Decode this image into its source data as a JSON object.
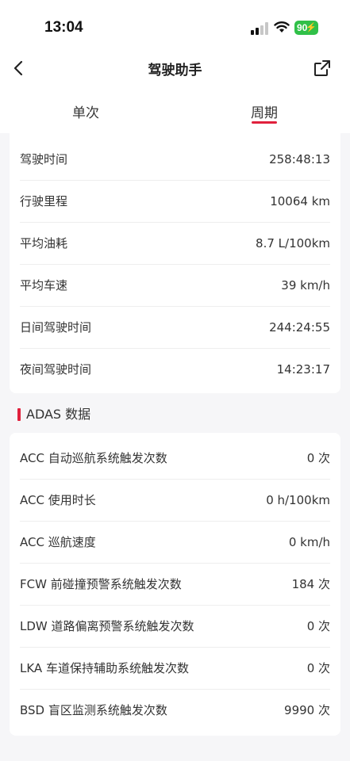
{
  "status_bar": {
    "time": "13:04",
    "battery": "90",
    "icons": [
      "signal-icon",
      "wifi-icon",
      "battery-charging-icon"
    ]
  },
  "header": {
    "title": "驾驶助手",
    "back_icon": "chevron-left-icon",
    "share_icon": "share-external-icon"
  },
  "tabs": [
    {
      "label": "单次",
      "active": false
    },
    {
      "label": "周期",
      "active": true
    }
  ],
  "colors": {
    "accent": "#e0203c",
    "battery": "#30c048",
    "background": "#f6f6f8"
  },
  "driving_stats": [
    {
      "label": "驾驶时间",
      "value": "258:48:13"
    },
    {
      "label": "行驶里程",
      "value": "10064 km"
    },
    {
      "label": "平均油耗",
      "value": "8.7 L/100km"
    },
    {
      "label": "平均车速",
      "value": "39 km/h"
    },
    {
      "label": "日间驾驶时间",
      "value": "244:24:55"
    },
    {
      "label": "夜间驾驶时间",
      "value": "14:23:17"
    }
  ],
  "adas": {
    "title": "ADAS 数据",
    "rows": [
      {
        "label": "ACC 自动巡航系统触发次数",
        "value": "0 次"
      },
      {
        "label": "ACC 使用时长",
        "value": "0 h/100km"
      },
      {
        "label": "ACC 巡航速度",
        "value": "0 km/h"
      },
      {
        "label": "FCW 前碰撞预警系统触发次数",
        "value": "184 次"
      },
      {
        "label": "LDW 道路偏离预警系统触发次数",
        "value": "0 次"
      },
      {
        "label": "LKA 车道保持辅助系统触发次数",
        "value": "0 次"
      },
      {
        "label": "BSD 盲区监测系统触发次数",
        "value": "9990 次"
      }
    ]
  }
}
